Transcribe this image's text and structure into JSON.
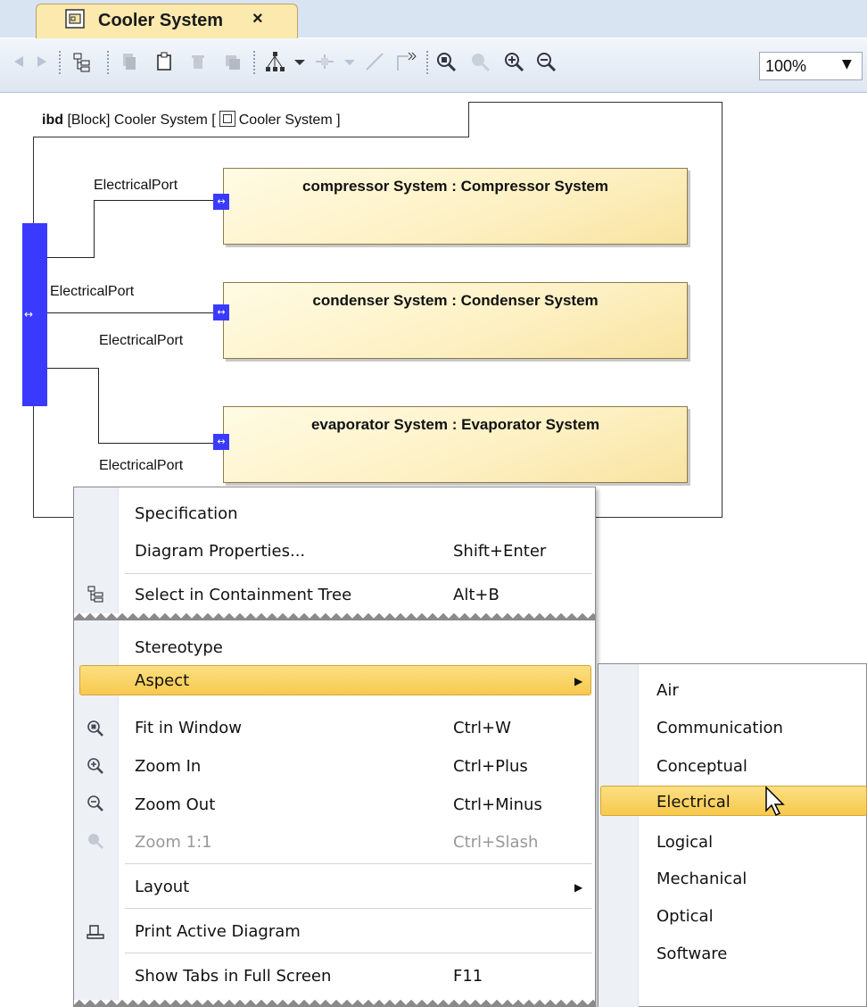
{
  "tab": {
    "title": "Cooler System",
    "close": "×"
  },
  "toolbar": {
    "zoom_value": "100%",
    "icons": [
      "back-icon",
      "forward-icon",
      "containment-tree-icon",
      "copy-icon",
      "paste-icon",
      "delete-icon",
      "delete-from-model-icon",
      "layout-icon",
      "dropdown-icon",
      "route-icon",
      "dropdown-icon",
      "path-icon",
      "path-style-icon",
      "fit-in-window-icon",
      "zoom-1-1-icon",
      "zoom-in-icon",
      "zoom-out-icon"
    ]
  },
  "diagram": {
    "frame_kind": "ibd",
    "frame_text": "[Block] Cooler System [",
    "frame_block": "Cooler System ]",
    "parts": [
      {
        "title": "compressor System : Compressor System"
      },
      {
        "title": "condenser System : Condenser System"
      },
      {
        "title": "evaporator System : Evaporator System"
      }
    ],
    "port_labels": [
      "ElectricalPort",
      "ElectricalPort",
      "ElectricalPort",
      "ElectricalPort"
    ],
    "port_color": "#3a3aff"
  },
  "context_menu": {
    "items": [
      {
        "label": "Specification",
        "shortcut": ""
      },
      {
        "label": "Diagram Properties...",
        "shortcut": "Shift+Enter"
      },
      {
        "label": "Select in Containment Tree",
        "shortcut": "Alt+B"
      },
      {
        "label": "Stereotype",
        "shortcut": ""
      },
      {
        "label": "Aspect",
        "shortcut": ""
      },
      {
        "label": "Fit in Window",
        "shortcut": "Ctrl+W"
      },
      {
        "label": "Zoom In",
        "shortcut": "Ctrl+Plus"
      },
      {
        "label": "Zoom Out",
        "shortcut": "Ctrl+Minus"
      },
      {
        "label": "Zoom 1:1",
        "shortcut": "Ctrl+Slash"
      },
      {
        "label": "Layout",
        "shortcut": ""
      },
      {
        "label": "Print Active Diagram",
        "shortcut": ""
      },
      {
        "label": "Show Tabs in Full Screen",
        "shortcut": "F11"
      }
    ],
    "highlight_color": "#f7c94d"
  },
  "aspect_submenu": {
    "items": [
      "Air",
      "Communication",
      "Conceptual",
      "Electrical",
      "Logical",
      "Mechanical",
      "Optical",
      "Software"
    ],
    "selected": "Electrical"
  }
}
